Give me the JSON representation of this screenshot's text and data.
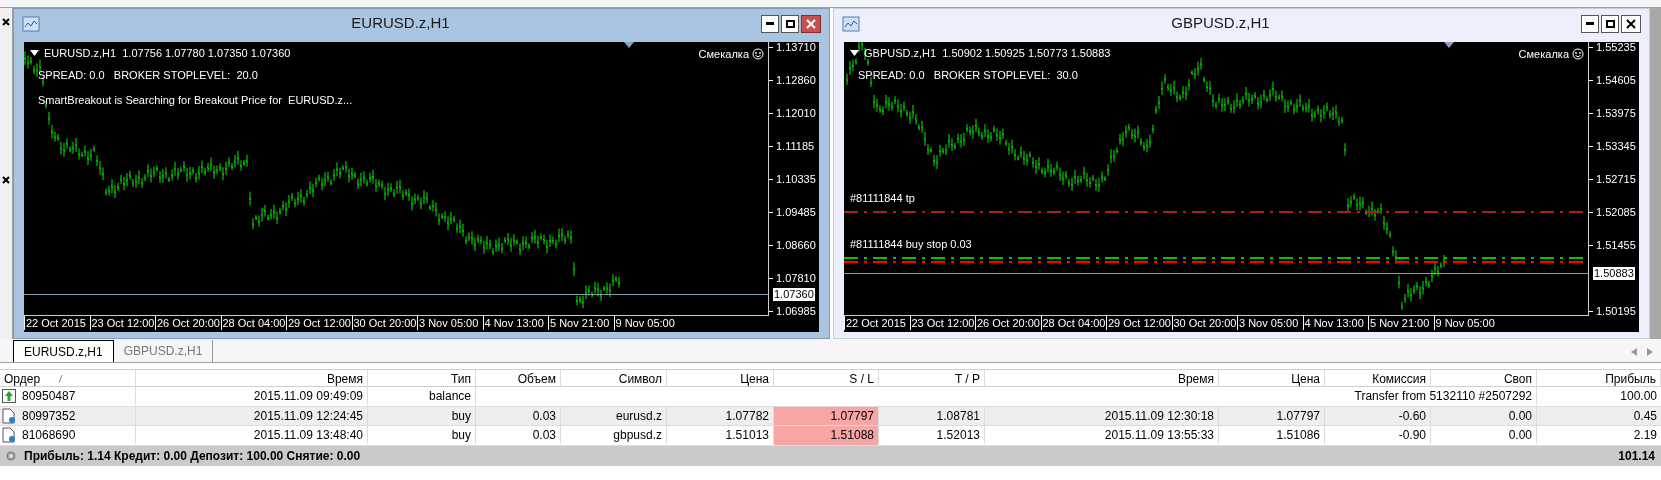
{
  "charts": [
    {
      "title": "EURUSD.z,H1",
      "active": true,
      "header": "EURUSD.z,H1  1.07756 1.07780 1.07350 1.07360",
      "indicator": "Смекалка",
      "info_lines": [
        "SPREAD: 0.0   BROKER STOPLEVEL:  20.0",
        "SmartBreakout is Searching for Breakout Price for  EURUSD.z..."
      ],
      "price_ticks": [
        "1.13710",
        "1.12860",
        "1.12010",
        "1.11185",
        "1.10335",
        "1.09485",
        "1.08660",
        "1.07810",
        "1.06985"
      ],
      "current_price": "1.07360",
      "time_labels": [
        "22 Oct 2015",
        "23 Oct 12:00",
        "26 Oct 20:00",
        "28 Oct 04:00",
        "29 Oct 12:00",
        "30 Oct 20:00",
        "3 Nov 05:00",
        "4 Nov 13:00",
        "5 Nov 21:00",
        "9 Nov 05:00"
      ]
    },
    {
      "title": "GBPUSD.z,H1",
      "active": false,
      "header": "GBPUSD.z,H1  1.50902 1.50925 1.50773 1.50883",
      "indicator": "Смекалка",
      "info_lines": [
        "SPREAD: 0.0   BROKER STOPLEVEL:  30.0"
      ],
      "price_ticks": [
        "1.55235",
        "1.54605",
        "1.53975",
        "1.53345",
        "1.52715",
        "1.52085",
        "1.51455",
        "1.50195"
      ],
      "current_price": "1.50883",
      "time_labels": [
        "22 Oct 2015",
        "23 Oct 12:00",
        "26 Oct 20:00",
        "28 Oct 04:00",
        "29 Oct 12:00",
        "30 Oct 20:00",
        "3 Nov 05:00",
        "4 Nov 13:00",
        "5 Nov 21:00",
        "9 Nov 05:00"
      ],
      "order_lines": [
        {
          "label": "#81111844 tp",
          "color": "#b01c1c"
        },
        {
          "label": "#81111844 buy stop 0.03",
          "color": "#00c800"
        },
        {
          "color": "#ff0000"
        }
      ]
    }
  ],
  "tabs": [
    {
      "label": "EURUSD.z,H1",
      "selected": true
    },
    {
      "label": "GBPUSD.z,H1",
      "selected": false
    }
  ],
  "table": {
    "columns": [
      "Ордер",
      "Время",
      "Тип",
      "Объем",
      "Символ",
      "Цена",
      "S / L",
      "T / P",
      "Время",
      "Цена",
      "Комиссия",
      "Своп",
      "Прибыль"
    ],
    "rows": [
      {
        "kind": "balance",
        "selected": false,
        "order": "80950487",
        "time": "2015.11.09 09:49:09",
        "type": "balance",
        "comment": "Transfer from 5132110 #2507292",
        "profit": "100.00"
      },
      {
        "kind": "order",
        "selected": true,
        "order": "80997352",
        "time": "2015.11.09 12:24:45",
        "type": "buy",
        "volume": "0.03",
        "symbol": "eurusd.z",
        "open_price": "1.07782",
        "sl": "1.07797",
        "sl_alert": true,
        "tp": "1.08781",
        "close_time": "2015.11.09 12:30:18",
        "close_price": "1.07797",
        "commission": "-0.60",
        "swap": "0.00",
        "profit": "0.45"
      },
      {
        "kind": "order",
        "selected": false,
        "order": "81068690",
        "time": "2015.11.09 13:48:40",
        "type": "buy",
        "volume": "0.03",
        "symbol": "gbpusd.z",
        "open_price": "1.51013",
        "sl": "1.51088",
        "sl_alert": true,
        "tp": "1.52013",
        "close_time": "2015.11.09 13:55:33",
        "close_price": "1.51086",
        "commission": "-0.90",
        "swap": "0.00",
        "profit": "2.19"
      }
    ]
  },
  "summary": {
    "text": "Прибыль: 1.14 Кредит: 0.00 Депозит: 100.00 Снятие: 0.00",
    "total": "101.14"
  }
}
